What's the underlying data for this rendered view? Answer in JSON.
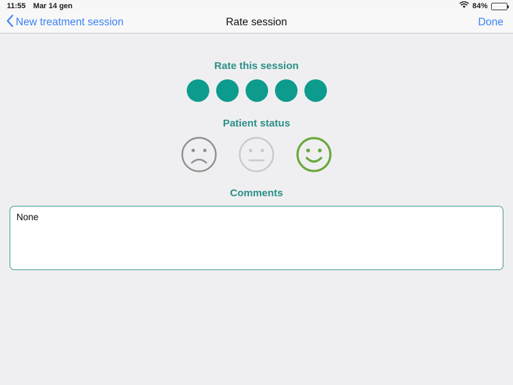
{
  "status_bar": {
    "time": "11:55",
    "date": "Mar 14 gen",
    "wifi_icon": "wifi-icon",
    "battery_percent": "84%",
    "battery_icon": "battery-icon",
    "battery_level": 84
  },
  "nav": {
    "back_icon": "chevron-left-icon",
    "back_label": "New treatment session",
    "title": "Rate session",
    "done_label": "Done"
  },
  "rating": {
    "title": "Rate this session",
    "max": 5,
    "value": 5,
    "dots": [
      {
        "filled": true
      },
      {
        "filled": true
      },
      {
        "filled": true
      },
      {
        "filled": true
      },
      {
        "filled": true
      }
    ]
  },
  "patient_status": {
    "title": "Patient status",
    "selected": "happy",
    "options": [
      {
        "id": "sad",
        "icon": "sad-face-icon",
        "label": "Sad",
        "selected": false
      },
      {
        "id": "neutral",
        "icon": "neutral-face-icon",
        "label": "Neutral",
        "selected": false
      },
      {
        "id": "happy",
        "icon": "happy-face-icon",
        "label": "Happy",
        "selected": true
      }
    ]
  },
  "comments": {
    "title": "Comments",
    "value": "None",
    "placeholder": "Comments"
  },
  "colors": {
    "teal_heading": "#2c9087",
    "teal_dot": "#0d9b8e",
    "blue_link": "#3a82f7",
    "green_selected": "#6aa83a",
    "gray_sad": "#8e8e8e",
    "gray_neutral": "#c9c9c9",
    "body_background": "#efeff1",
    "border_teal": "#3e9a93"
  }
}
